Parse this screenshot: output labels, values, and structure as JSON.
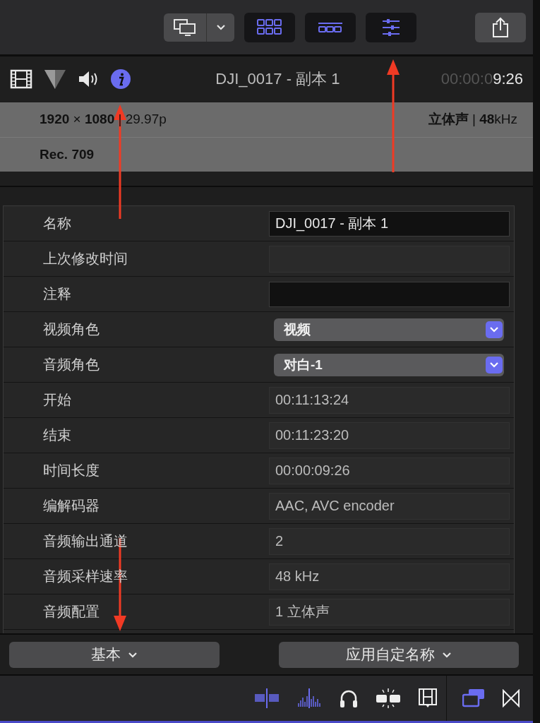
{
  "toolbar": {
    "buttons": [
      {
        "kind": "grid",
        "selected": true
      },
      {
        "kind": "filmstrip",
        "selected": true
      },
      {
        "kind": "sliders",
        "selected": true
      }
    ]
  },
  "header": {
    "tabs": [
      {
        "kind": "film",
        "selected": false
      },
      {
        "kind": "color",
        "selected": false
      },
      {
        "kind": "audio",
        "selected": false
      },
      {
        "kind": "info",
        "selected": true
      }
    ],
    "title": "DJI_0017 - 副本 1",
    "timecode": {
      "dim": "00:00:0",
      "bright": "9:26"
    }
  },
  "info_panel": {
    "video_format": "**1920** × **1080** | 29.97p",
    "audio_format": "**立体声** | **48**kHz",
    "color_space": "Rec. 709"
  },
  "properties": [
    {
      "label": "名称",
      "kind": "text",
      "value": "DJI_0017 - 副本 1"
    },
    {
      "label": "上次修改时间",
      "kind": "readonly"
    },
    {
      "label": "注释",
      "kind": "text"
    },
    {
      "label": "视频角色",
      "kind": "popup",
      "value": "视频"
    },
    {
      "label": "音频角色",
      "kind": "popup",
      "value": "对白-1"
    },
    {
      "label": "开始",
      "kind": "readonly",
      "value": "00:11:13:24"
    },
    {
      "label": "结束",
      "kind": "readonly",
      "value": "00:11:23:20"
    },
    {
      "label": "时间长度",
      "kind": "readonly",
      "value": "00:00:09:26"
    },
    {
      "label": "编解码器",
      "kind": "readonly",
      "value": "AAC, AVC encoder"
    },
    {
      "label": "音频输出通道",
      "kind": "readonly",
      "value": "2"
    },
    {
      "label": "音频采样速率",
      "kind": "readonly",
      "value": "48 kHz"
    },
    {
      "label": "音频配置",
      "kind": "readonly",
      "value": "1 立体声"
    }
  ],
  "bottom_buttons": [
    {
      "label": "基本"
    },
    {
      "label": "应用自定名称"
    }
  ],
  "footer_tools": [
    {
      "kind": "clip",
      "selected": true
    },
    {
      "kind": "wave",
      "selected": true
    },
    {
      "kind": "headphones",
      "selected": false
    },
    {
      "kind": "split",
      "selected": false
    },
    {
      "kind": "filmstrip",
      "selected": false
    }
  ],
  "footer_right": [
    {
      "kind": "windows",
      "selected": true
    },
    {
      "kind": "bowtie",
      "selected": false
    }
  ]
}
